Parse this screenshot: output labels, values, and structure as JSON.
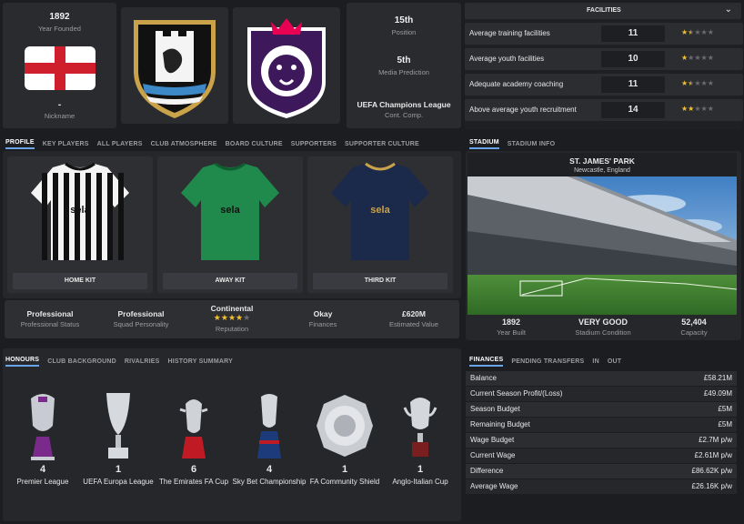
{
  "club_info": {
    "year_founded": "1892",
    "year_founded_label": "Year Founded",
    "nickname": "-",
    "nickname_label": "Nickname",
    "position": "15th",
    "position_label": "Position",
    "media_prediction": "5th",
    "media_prediction_label": "Media Prediction",
    "cont_comp": "UEFA Champions League",
    "cont_comp_label": "Cont. Comp."
  },
  "facilities": {
    "header": "FACILITIES",
    "rows": [
      {
        "name": "Average training facilities",
        "value": "11",
        "stars": 1.5
      },
      {
        "name": "Average youth facilities",
        "value": "10",
        "stars": 1
      },
      {
        "name": "Adequate academy coaching",
        "value": "11",
        "stars": 1.5
      },
      {
        "name": "Above average youth recruitment",
        "value": "14",
        "stars": 2
      }
    ]
  },
  "profile_tabs": [
    "PROFILE",
    "KEY PLAYERS",
    "ALL PLAYERS",
    "CLUB ATMOSPHERE",
    "BOARD CULTURE",
    "SUPPORTERS",
    "SUPPORTER CULTURE"
  ],
  "kits": [
    {
      "label": "HOME KIT",
      "sponsor": "sela"
    },
    {
      "label": "AWAY KIT",
      "sponsor": "sela"
    },
    {
      "label": "THIRD KIT",
      "sponsor": "sela"
    }
  ],
  "status": [
    {
      "value": "Professional",
      "label": "Professional Status"
    },
    {
      "value": "Professional",
      "label": "Squad Personality"
    },
    {
      "value": "Continental",
      "label": "Reputation",
      "stars": 4
    },
    {
      "value": "Okay",
      "label": "Finances"
    },
    {
      "value": "£620M",
      "label": "Estimated Value"
    }
  ],
  "stadium_tabs": [
    "STADIUM",
    "STADIUM INFO"
  ],
  "stadium": {
    "name": "ST. JAMES' PARK",
    "location": "Newcastle, England",
    "year_built": "1892",
    "year_built_label": "Year Built",
    "condition": "VERY GOOD",
    "condition_label": "Stadium Condition",
    "capacity": "52,404",
    "capacity_label": "Capacity"
  },
  "honours_tabs": [
    "HONOURS",
    "CLUB BACKGROUND",
    "RIVALRIES",
    "HISTORY SUMMARY"
  ],
  "honours": [
    {
      "count": "4",
      "name": "Premier League"
    },
    {
      "count": "1",
      "name": "UEFA Europa League"
    },
    {
      "count": "6",
      "name": "The Emirates FA Cup"
    },
    {
      "count": "4",
      "name": "Sky Bet Championship"
    },
    {
      "count": "1",
      "name": "FA Community Shield"
    },
    {
      "count": "1",
      "name": "Anglo-Italian Cup"
    }
  ],
  "finances_tabs": [
    "FINANCES",
    "PENDING TRANSFERS",
    "IN",
    "OUT"
  ],
  "finances": [
    {
      "k": "Balance",
      "v": "£58.21M"
    },
    {
      "k": "Current Season Profit/(Loss)",
      "v": "£49.09M"
    },
    {
      "k": "Season Budget",
      "v": "£5M"
    },
    {
      "k": "Remaining Budget",
      "v": "£5M"
    },
    {
      "k": "Wage Budget",
      "v": "£2.7M p/w"
    },
    {
      "k": "Current Wage",
      "v": "£2.61M p/w"
    },
    {
      "k": "Difference",
      "v": "£86.62K p/w"
    },
    {
      "k": "Average Wage",
      "v": "£26.16K p/w"
    }
  ],
  "colors": {
    "accent_tab": "#6aa3e8",
    "star_on": "#f2c12e",
    "star_off": "#6b6c70"
  }
}
